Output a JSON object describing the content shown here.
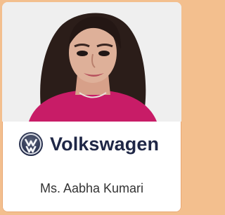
{
  "profile": {
    "name": "Ms. Aabha Kumari",
    "photo_alt": "Ms. Aabha Kumari",
    "company_logo": {
      "brand_text": "Volkswagen",
      "emblem_icon": "volkswagen-emblem-icon",
      "color": "#1f2746"
    },
    "accent_color": "#f3bf8e"
  }
}
